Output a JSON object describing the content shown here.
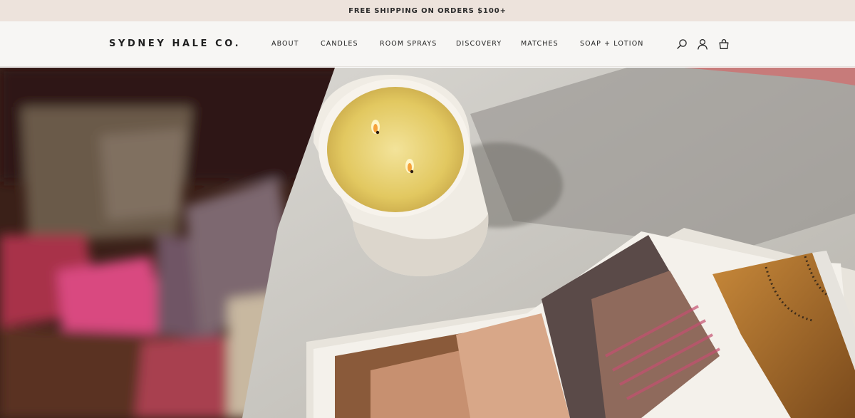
{
  "announcement": {
    "text": "FREE SHIPPING ON ORDERS $100+"
  },
  "header": {
    "logo": "SYDNEY HALE CO.",
    "nav": [
      {
        "label": "ABOUT"
      },
      {
        "label": "CANDLES"
      },
      {
        "label": "ROOM SPRAYS"
      },
      {
        "label": "DISCOVERY"
      },
      {
        "label": "MATCHES"
      },
      {
        "label": "SOAP + LOTION"
      }
    ],
    "icons": [
      "search-icon",
      "account-icon",
      "cart-icon"
    ]
  },
  "hero": {
    "image": "lit two-wick candle on marble table beside folded magazine"
  },
  "colors": {
    "announcement_bg": "#ede3dc",
    "header_bg": "#f7f6f4",
    "text": "#222222"
  }
}
